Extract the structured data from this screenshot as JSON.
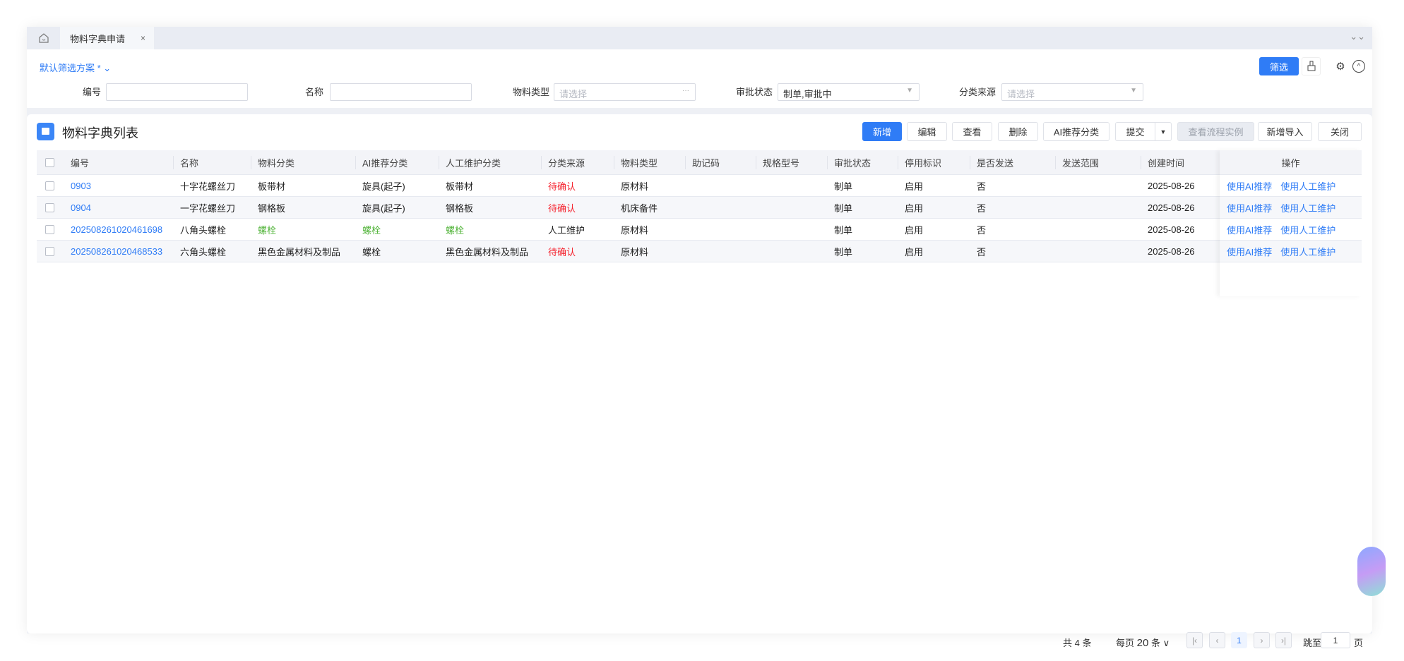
{
  "tabs": [
    {
      "label": "物料字典申请",
      "close": "×"
    }
  ],
  "filter": {
    "scheme": "默认筛选方案 *",
    "fields": [
      {
        "label": "编号",
        "value": "",
        "placeholder": ""
      },
      {
        "label": "名称",
        "value": "",
        "placeholder": ""
      },
      {
        "label": "物料类型",
        "value": "",
        "placeholder": "请选择"
      },
      {
        "label": "审批状态",
        "value": "制单,审批中",
        "placeholder": ""
      },
      {
        "label": "分类来源",
        "value": "",
        "placeholder": "请选择"
      }
    ],
    "filter_button": "筛选"
  },
  "panel": {
    "title": "物料字典列表",
    "toolbar": {
      "add": "新增",
      "edit": "编辑",
      "view": "查看",
      "delete": "删除",
      "ai_classify": "AI推荐分类",
      "submit": "提交",
      "view_flow": "查看流程实例",
      "import": "新增导入",
      "close": "关闭"
    }
  },
  "table": {
    "columns": [
      "编号",
      "名称",
      "物料分类",
      "AI推荐分类",
      "人工维护分类",
      "分类来源",
      "物料类型",
      "助记码",
      "规格型号",
      "审批状态",
      "停用标识",
      "是否发送",
      "发送范围",
      "创建时间",
      "操作"
    ],
    "rows": [
      [
        "0903",
        "十字花螺丝刀",
        "板带材",
        "旋具(起子)",
        "板带材",
        "待确认",
        "原材料",
        "",
        "",
        "制单",
        "启用",
        "否",
        "",
        "2025-08-26"
      ],
      [
        "0904",
        "一字花螺丝刀",
        "钢格板",
        "旋具(起子)",
        "钢格板",
        "待确认",
        "机床备件",
        "",
        "",
        "制单",
        "启用",
        "否",
        "",
        "2025-08-26"
      ],
      [
        "202508261020461698",
        "八角头螺栓",
        "螺栓",
        "螺栓",
        "螺栓",
        "人工维护",
        "原材料",
        "",
        "",
        "制单",
        "启用",
        "否",
        "",
        "2025-08-26"
      ],
      [
        "202508261020468533",
        "六角头螺栓",
        "黑色金属材料及制品",
        "螺栓",
        "黑色金属材料及制品",
        "待确认",
        "原材料",
        "",
        "",
        "制单",
        "启用",
        "否",
        "",
        "2025-08-26"
      ]
    ],
    "actions": [
      "使用AI推荐",
      "使用人工维护"
    ]
  },
  "pagination": {
    "total": "共 4 条",
    "page_size_prefix": "每页",
    "page_size": "20",
    "page_size_suffix": "条",
    "current": "1",
    "jump_label": "跳至",
    "jump_value": "1",
    "page_suffix": "页"
  },
  "colors": {
    "primary": "#2f7cf6",
    "pending": "#f5222d",
    "ai": "#52b43a"
  }
}
